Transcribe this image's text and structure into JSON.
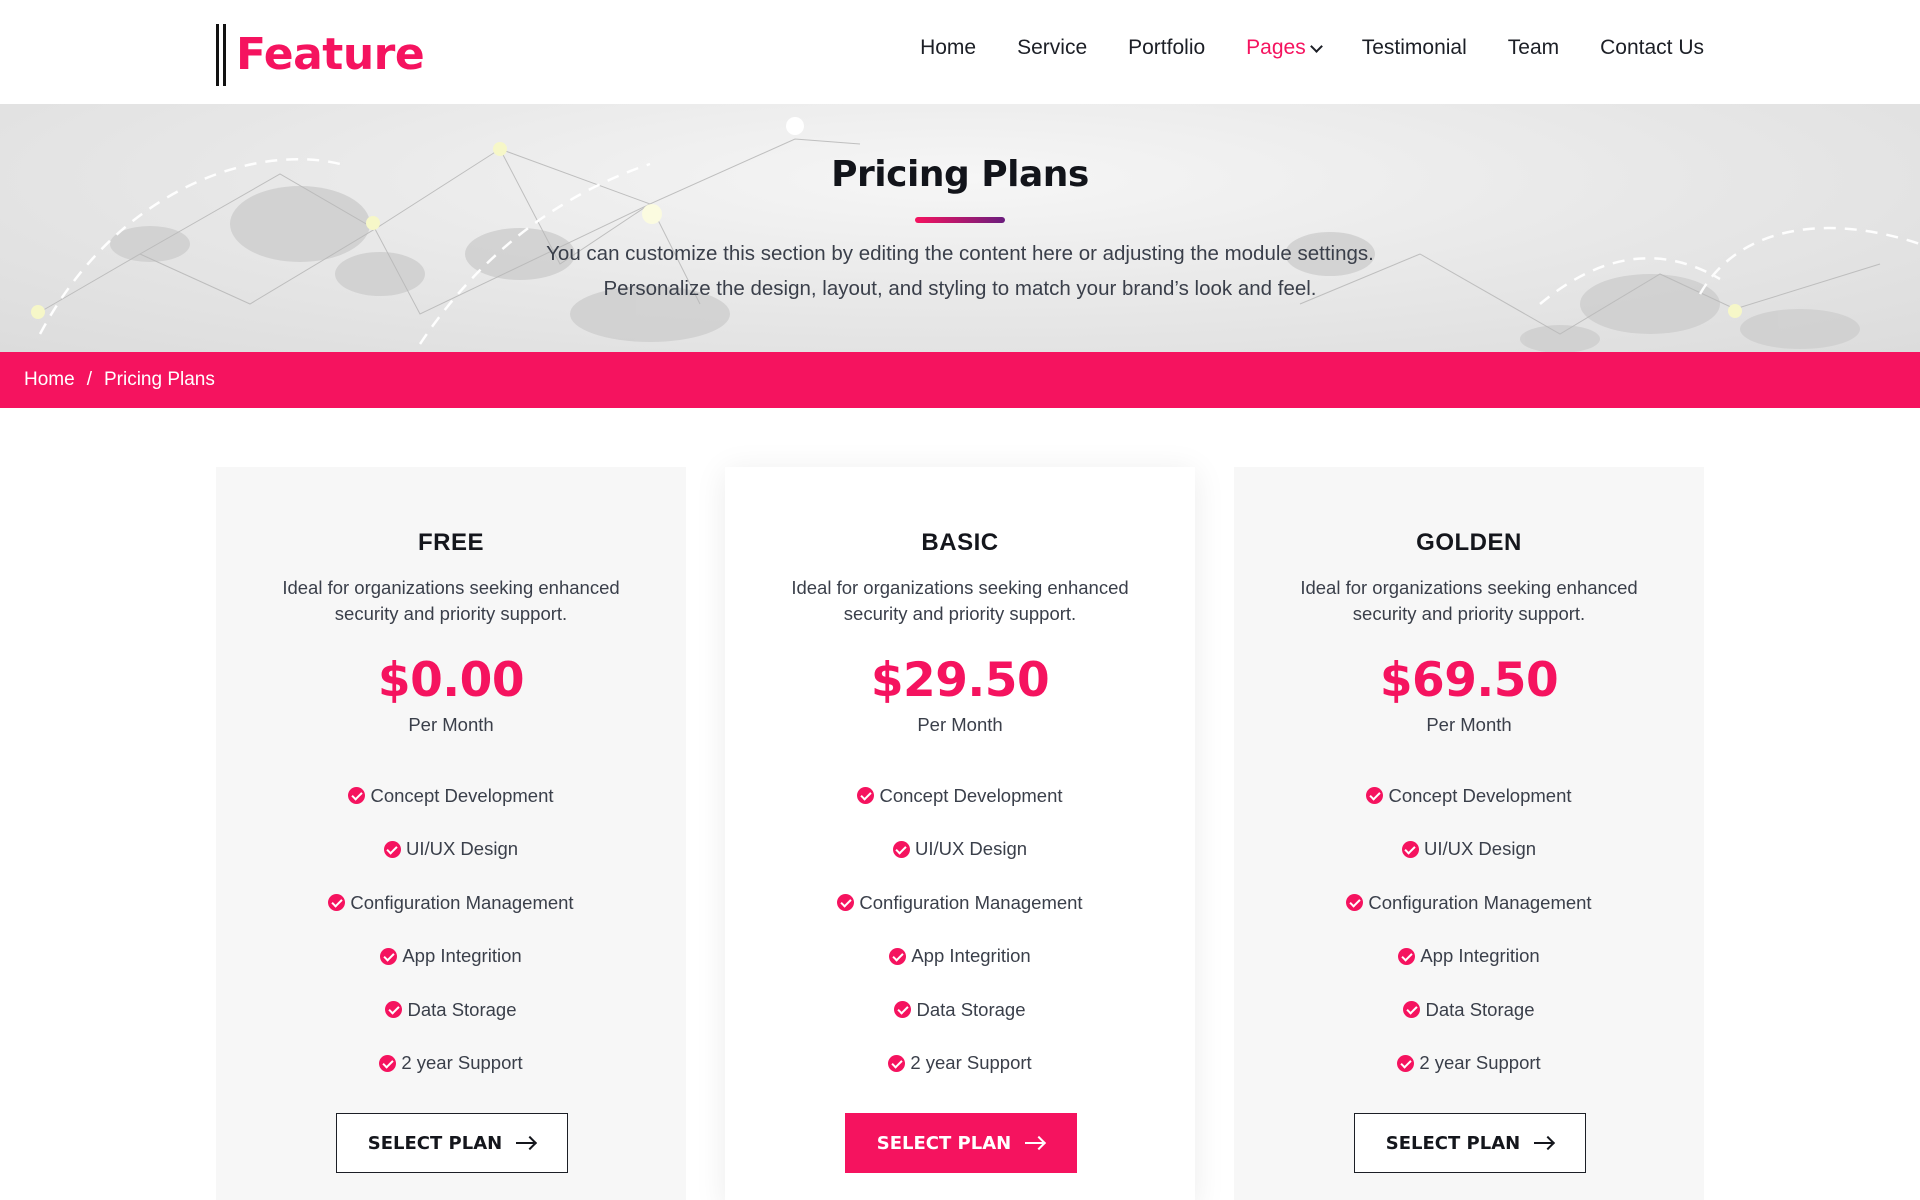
{
  "brand": {
    "name": "Feature",
    "accent": "#f5135f"
  },
  "nav": {
    "items": [
      {
        "label": "Home"
      },
      {
        "label": "Service"
      },
      {
        "label": "Portfolio"
      },
      {
        "label": "Pages"
      },
      {
        "label": "Testimonial"
      },
      {
        "label": "Team"
      },
      {
        "label": "Contact Us"
      }
    ],
    "active": "Pages"
  },
  "hero": {
    "title": "Pricing Plans",
    "subtitle_line1": "You can customize this section by editing the content here or adjusting the module settings.",
    "subtitle_line2": "Personalize the design, layout, and styling to match your brand’s look and feel."
  },
  "breadcrumb": {
    "home": "Home",
    "separator": "/",
    "current": "Pricing Plans"
  },
  "plans": [
    {
      "name": "FREE",
      "description": "Ideal for organizations seeking enhanced security and priority support.",
      "price": "$0.00",
      "period": "Per Month",
      "features": [
        "Concept Development",
        "UI/UX Design",
        "Configuration Management",
        "App Integrition",
        "Data Storage",
        "2 year Support"
      ],
      "button": "SELECT PLAN"
    },
    {
      "name": "BASIC",
      "description": "Ideal for organizations seeking enhanced security and priority support.",
      "price": "$29.50",
      "period": "Per Month",
      "features": [
        "Concept Development",
        "UI/UX Design",
        "Configuration Management",
        "App Integrition",
        "Data Storage",
        "2 year Support"
      ],
      "button": "SELECT PLAN"
    },
    {
      "name": "GOLDEN",
      "description": "Ideal for organizations seeking enhanced security and priority support.",
      "price": "$69.50",
      "period": "Per Month",
      "features": [
        "Concept Development",
        "UI/UX Design",
        "Configuration Management",
        "App Integrition",
        "Data Storage",
        "2 year Support"
      ],
      "button": "SELECT PLAN"
    }
  ]
}
